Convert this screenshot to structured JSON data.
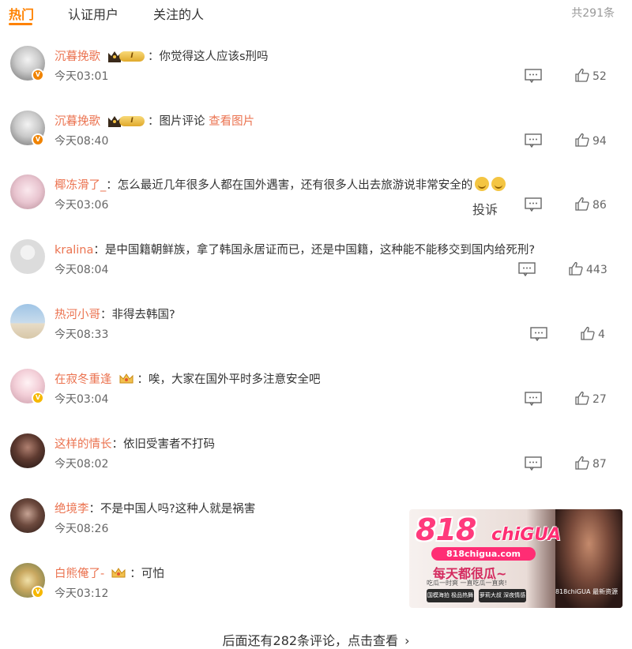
{
  "tabs": [
    {
      "label": "热门",
      "active": true
    },
    {
      "label": "认证用户",
      "active": false
    },
    {
      "label": "关注的人",
      "active": false
    }
  ],
  "total_count": "共291条",
  "comments": [
    {
      "username": "沉暮挽歌",
      "text": "你觉得这人应该s刑吗",
      "time": "今天03:01",
      "likes": "52",
      "badge": "crown-level-1"
    },
    {
      "username": "沉暮挽歌",
      "text": "图片评论",
      "link": "查看图片",
      "time": "今天08:40",
      "likes": "94",
      "badge": "crown-level-1"
    },
    {
      "username": "椰冻滑了_",
      "text": "怎么最近几年很多人都在国外遇害，还有很多人出去旅游说非常安全的",
      "time": "今天03:06",
      "likes": "86",
      "report": "投诉"
    },
    {
      "username": "kralina",
      "text": "是中国籍朝鲜族，拿了韩国永居证而已，还是中国籍，这种能不能移交到国内给死刑?",
      "time": "今天08:04",
      "likes": "443"
    },
    {
      "username": "热河小哥",
      "text": "非得去韩国?",
      "time": "今天08:33",
      "likes": "4"
    },
    {
      "username": "在寂冬重逢",
      "text": "唉，大家在国外平时多注意安全吧",
      "time": "今天03:04",
      "likes": "27",
      "badge": "small-crown"
    },
    {
      "username": "这样的情长",
      "text": "依旧受害者不打码",
      "time": "今天08:02",
      "likes": "87"
    },
    {
      "username": "绝境李",
      "text": "不是中国人吗?这种人就是祸害",
      "time": "今天08:26"
    },
    {
      "username": "白熊俺了-",
      "text": "可怕",
      "time": "今天03:12",
      "badge": "small-crown"
    }
  ],
  "level_label": "I",
  "separator": "：",
  "more": "后面还有282条评论，点击查看",
  "ad": {
    "logo_num": "818",
    "logo_word": "chiGUA",
    "domain": "818chigua.com",
    "slogan": "每天都很瓜~",
    "tagline": "吃瓜一时爽 一直吃瓜一直爽!",
    "btn1": "国模海拍 极品热舞",
    "btn2": "萝莉大叔 深夜情感",
    "brand": "818chiGUA 最新资源"
  },
  "colors": {
    "accent": "#ff8200",
    "username": "#eb7350",
    "muted": "#999999"
  }
}
